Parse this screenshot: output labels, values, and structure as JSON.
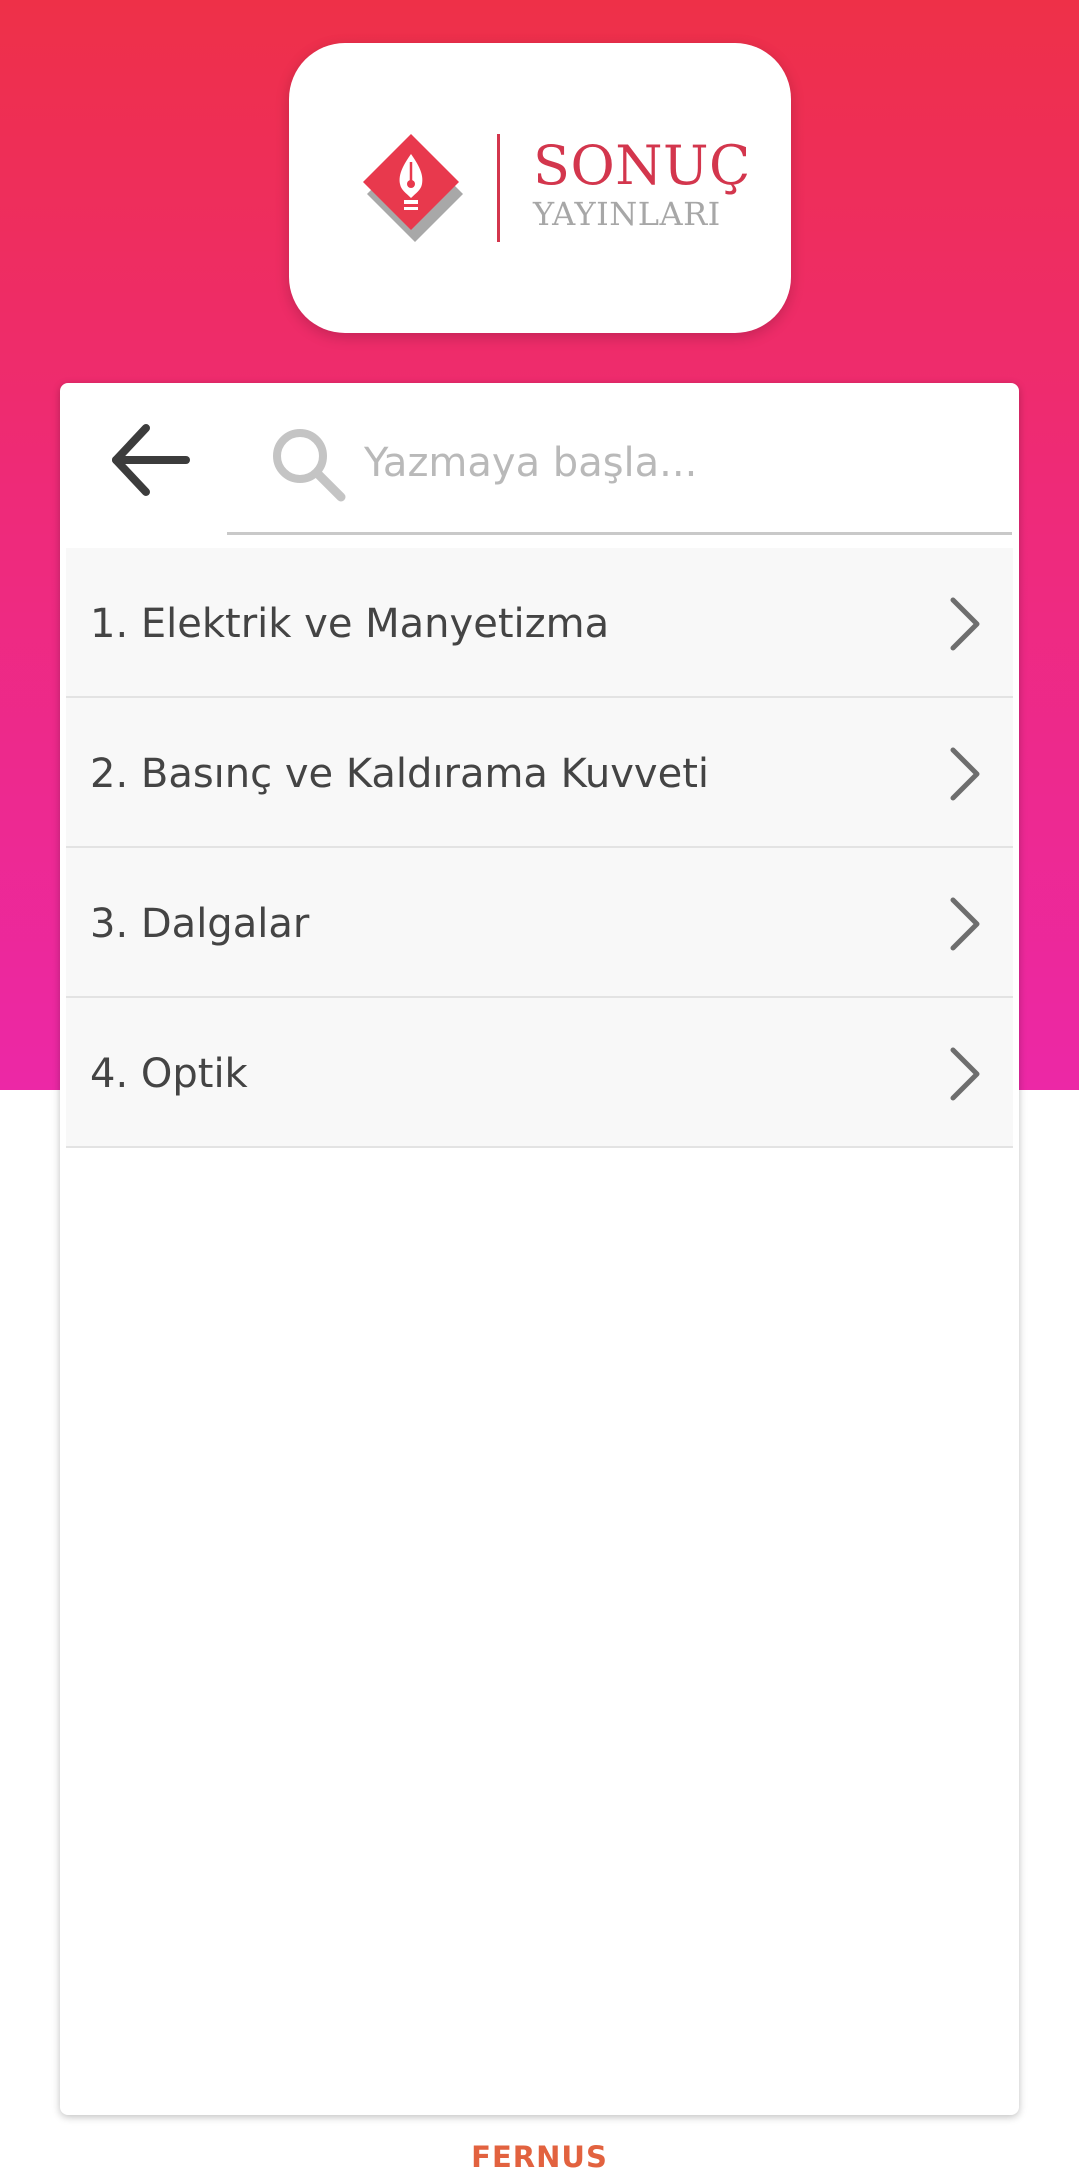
{
  "logo": {
    "title": "SONUÇ",
    "subtitle": "YAYINLARI"
  },
  "search": {
    "placeholder": "Yazmaya başla..."
  },
  "list": {
    "items": [
      {
        "label": "1. Elektrik ve Manyetizma"
      },
      {
        "label": "2. Basınç ve Kaldırama Kuvveti"
      },
      {
        "label": "3. Dalgalar"
      },
      {
        "label": "4. Optik"
      }
    ]
  },
  "footer": {
    "brand": "FERNUS"
  },
  "icons": {
    "back": "arrow-left-icon",
    "search": "search-icon",
    "chevron": "chevron-right-icon",
    "logo": "pen-nib-icon"
  },
  "colors": {
    "gradient_top": "#ee3048",
    "gradient_bottom": "#ec28a6",
    "brand_red": "#d3364d",
    "footer_orange": "#e2623f"
  }
}
